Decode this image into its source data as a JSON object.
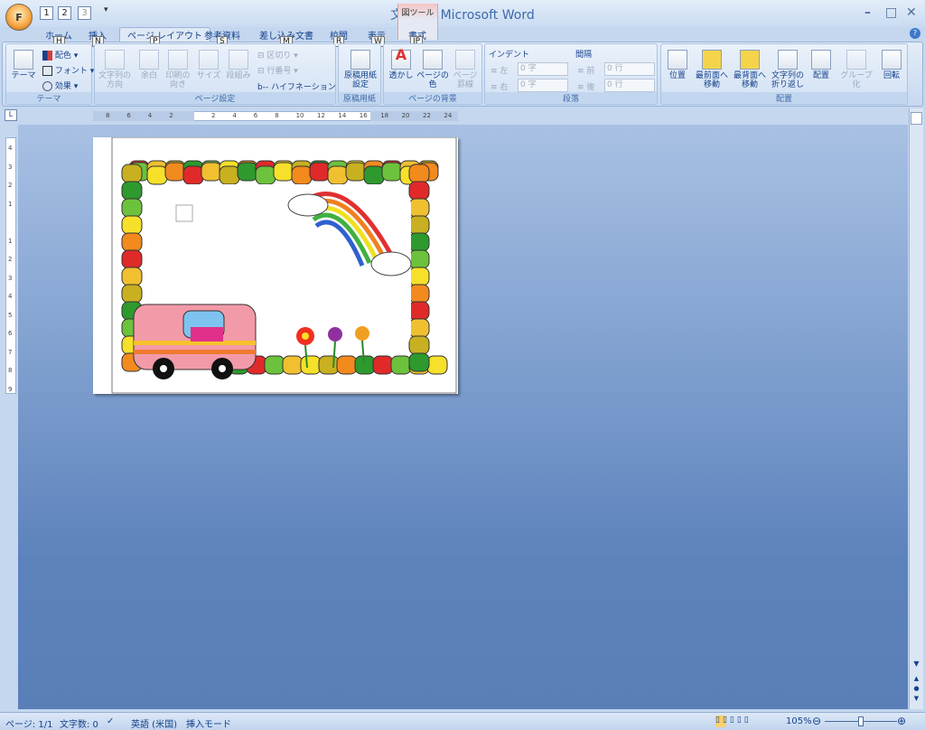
{
  "window": {
    "title": "文書 1 - Microsoft Word",
    "office_key": "F",
    "qat_keys": [
      "1",
      "2",
      "3"
    ],
    "context_tab": "図ツール",
    "minimize": "–",
    "maximize": "□",
    "close": "✕",
    "help": "?"
  },
  "tabs": [
    {
      "label": "ホーム",
      "key": "H"
    },
    {
      "label": "挿入",
      "key": "N"
    },
    {
      "label": "ページ レイアウト",
      "key": "P",
      "active": true
    },
    {
      "label": "参考資料",
      "key": "S"
    },
    {
      "label": "差し込み文書",
      "key": "M"
    },
    {
      "label": "校閲",
      "key": "R"
    },
    {
      "label": "表示",
      "key": "W"
    },
    {
      "label": "書式",
      "key": "JP"
    }
  ],
  "ribbon": {
    "theme": {
      "label": "テーマ",
      "themes": "テーマ",
      "colors": "配色",
      "fonts": "フォント",
      "effects": "効果"
    },
    "page_setup": {
      "label": "ページ設定",
      "text_direction": "文字列の方向",
      "margins": "余白",
      "orientation": "印刷の向き",
      "size": "サイズ",
      "columns": "段組み",
      "breaks": "区切り",
      "line_numbers": "行番号",
      "hyphenation": "ハイフネーション"
    },
    "manuscript": {
      "label": "原稿用紙",
      "settings": "原稿用紙設定"
    },
    "page_background": {
      "label": "ページの背景",
      "watermark": "透かし",
      "page_color": "ページの色",
      "page_borders": "ページ罫線"
    },
    "paragraph": {
      "label": "段落",
      "indent": "インデント",
      "left": "左",
      "right": "右",
      "left_value": "0 字",
      "right_value": "0 字",
      "spacing": "間隔",
      "before": "前",
      "after": "後",
      "before_value": "0 行",
      "after_value": "0 行"
    },
    "arrange": {
      "label": "配置",
      "position": "位置",
      "bring_front": "最前面へ移動",
      "send_back": "最背面へ移動",
      "wrap": "文字列の折り返し",
      "align": "配置",
      "group": "グループ化",
      "rotate": "回転"
    }
  },
  "ruler": {
    "ticks": [
      "8",
      "6",
      "4",
      "2",
      "",
      "2",
      "4",
      "6",
      "8",
      "10",
      "12",
      "14",
      "16",
      "18",
      "20",
      "22",
      "24"
    ]
  },
  "vruler": {
    "ticks": [
      "4",
      "3",
      "2",
      "1",
      "",
      "1",
      "2",
      "3",
      "4",
      "5",
      "6",
      "7",
      "8",
      "9"
    ]
  },
  "status": {
    "page": "ページ: 1/1",
    "words": "文字数: 0",
    "language": "英語 (米国)",
    "mode": "挿入モード",
    "zoom": "105%",
    "zoom_level": 105
  }
}
